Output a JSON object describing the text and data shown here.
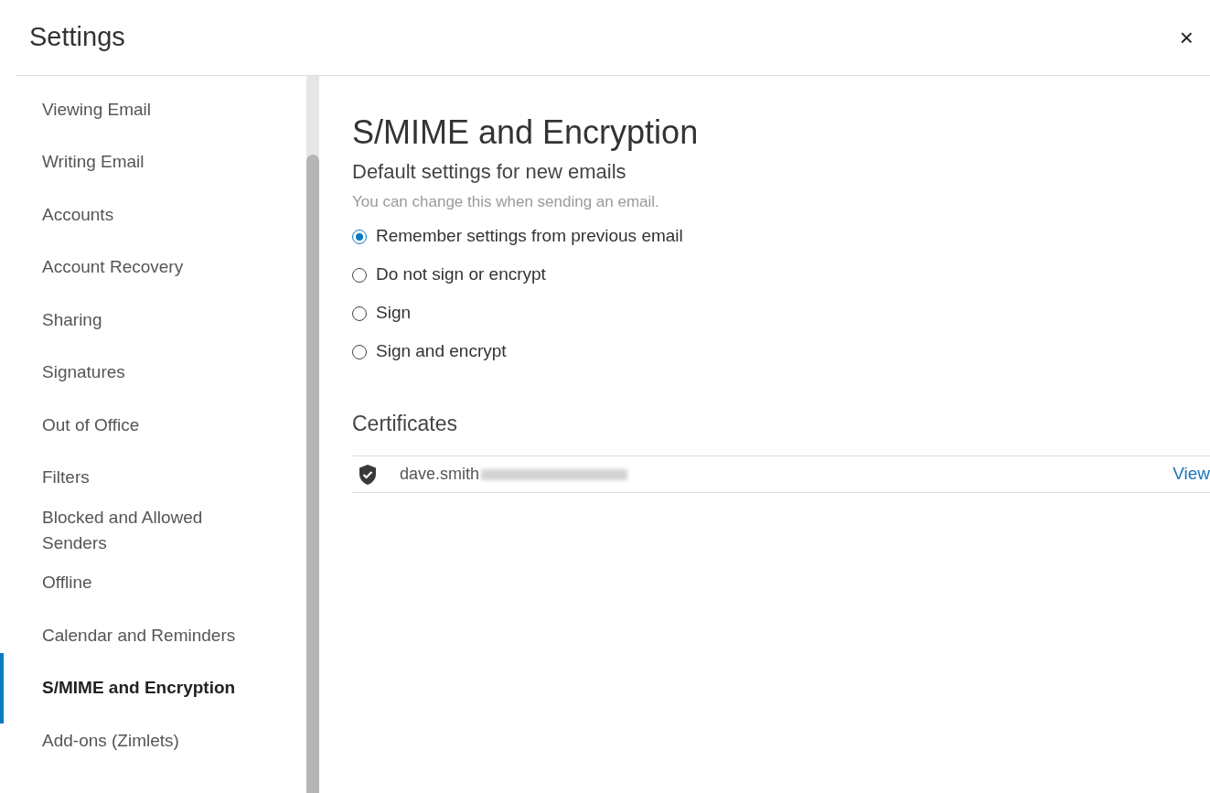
{
  "window": {
    "title": "Settings",
    "close": "×"
  },
  "sidebar": {
    "items": [
      {
        "label": "Viewing Email",
        "selected": false
      },
      {
        "label": "Writing Email",
        "selected": false
      },
      {
        "label": "Accounts",
        "selected": false
      },
      {
        "label": "Account Recovery",
        "selected": false
      },
      {
        "label": "Sharing",
        "selected": false
      },
      {
        "label": "Signatures",
        "selected": false
      },
      {
        "label": "Out of Office",
        "selected": false
      },
      {
        "label": "Filters",
        "selected": false
      },
      {
        "label": "Blocked and Allowed Senders",
        "selected": false
      },
      {
        "label": "Offline",
        "selected": false
      },
      {
        "label": "Calendar and Reminders",
        "selected": false
      },
      {
        "label": "S/MIME and Encryption",
        "selected": true
      },
      {
        "label": "Add-ons (Zimlets)",
        "selected": false
      }
    ]
  },
  "content": {
    "title": "S/MIME and Encryption",
    "subtitle": "Default settings for new emails",
    "hint": "You can change this when sending an email.",
    "options": [
      {
        "label": "Remember settings from previous email",
        "selected": true
      },
      {
        "label": "Do not sign or encrypt",
        "selected": false
      },
      {
        "label": "Sign",
        "selected": false
      },
      {
        "label": "Sign and encrypt",
        "selected": false
      }
    ],
    "certificates": {
      "title": "Certificates",
      "items": [
        {
          "email": "dave.smith",
          "redacted": true,
          "action": "View"
        }
      ]
    }
  }
}
